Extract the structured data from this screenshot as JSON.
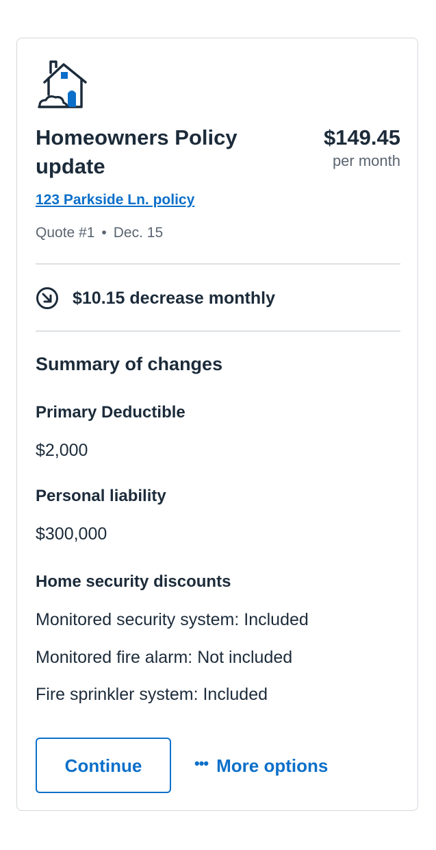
{
  "policy": {
    "title": "Homeowners Policy update",
    "price": "$149.45",
    "price_period": "per month",
    "link_text": "123 Parkside Ln. policy",
    "quote": "Quote #1",
    "separator": "•",
    "date": "Dec. 15",
    "icon": "house-icon"
  },
  "change": {
    "icon": "arrow-down-right-circle-icon",
    "text": "$10.15 decrease monthly"
  },
  "summary": {
    "title": "Summary of changes",
    "items": [
      {
        "label": "Primary Deductible",
        "value": "$2,000"
      },
      {
        "label": "Personal liability",
        "value": "$300,000"
      }
    ],
    "discounts": {
      "label": "Home security discounts",
      "lines": [
        "Monitored security system: Included",
        "Monitored fire alarm: Not included",
        "Fire sprinkler system: Included"
      ]
    }
  },
  "actions": {
    "continue_label": "Continue",
    "more_label": "More options",
    "more_icon": "ellipsis-icon"
  },
  "colors": {
    "accent": "#0b6fc9",
    "text": "#1c2b3a",
    "muted": "#5a6470",
    "border": "#d3d7dc"
  }
}
